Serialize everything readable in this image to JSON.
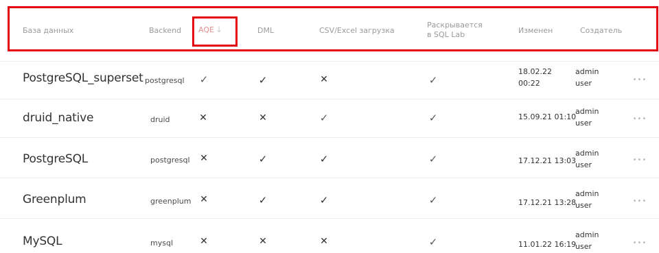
{
  "header": {
    "columns": {
      "database": "База данных",
      "backend": "Backend",
      "aqe": "AQE",
      "dml": "DML",
      "csv_upload": "CSV/Excel загрузка",
      "sql_lab_line1": "Раскрывается",
      "sql_lab_line2": "в SQL Lab",
      "modified": "Изменен",
      "creator": "Создатель"
    },
    "sort_indicator": "↓"
  },
  "rows": [
    {
      "name": "PostgreSQL_superset",
      "backend": "postgresql",
      "aqe": "✓",
      "dml": "✓",
      "csv": "✕",
      "sql_lab": "✓",
      "modified_line1": "18.02.22",
      "modified_line2": "00:22",
      "creator_line1": "admin",
      "creator_line2": "user",
      "menu": "•••"
    },
    {
      "name": "druid_native",
      "backend": "druid",
      "aqe": "✕",
      "dml": "✕",
      "csv": "✓",
      "sql_lab": "✓",
      "modified_line1": "15.09.21 01:10",
      "modified_line2": "",
      "creator_line1": "admin",
      "creator_line2": "user",
      "menu": "•••"
    },
    {
      "name": "PostgreSQL",
      "backend": "postgresql",
      "aqe": "✕",
      "dml": "✓",
      "csv": "✓",
      "sql_lab": "✓",
      "modified_line1": "17.12.21 13:03",
      "modified_line2": "",
      "creator_line1": "admin",
      "creator_line2": "user",
      "menu": "•••"
    },
    {
      "name": "Greenplum",
      "backend": "greenplum",
      "aqe": "✕",
      "dml": "✓",
      "csv": "✓",
      "sql_lab": "✓",
      "modified_line1": "17.12.21 13:28",
      "modified_line2": "",
      "creator_line1": "admin",
      "creator_line2": "user",
      "menu": "•••"
    },
    {
      "name": "MySQL",
      "backend": "mysql",
      "aqe": "✕",
      "dml": "✕",
      "csv": "✕",
      "sql_lab": "✓",
      "modified_line1": "11.01.22 16:19",
      "modified_line2": "",
      "creator_line1": "admin",
      "creator_line2": "user",
      "menu": "•••"
    }
  ],
  "colors": {
    "highlight_outline": "#e3000f",
    "text_primary": "#323232",
    "text_header": "#9a9a9a"
  }
}
